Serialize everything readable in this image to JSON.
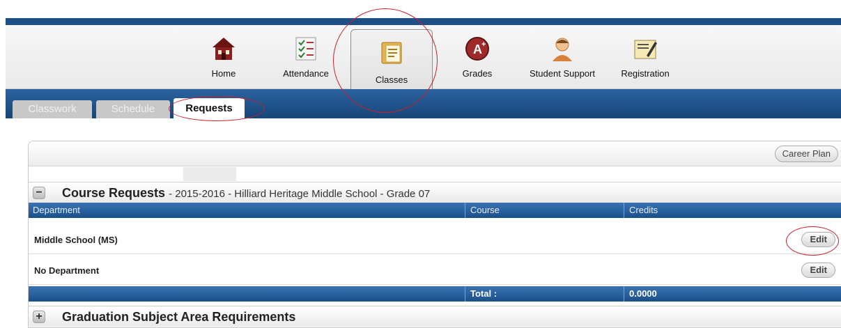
{
  "nav": {
    "items": [
      {
        "label": "Home",
        "icon": "home-icon"
      },
      {
        "label": "Attendance",
        "icon": "attendance-icon"
      },
      {
        "label": "Classes",
        "icon": "classes-icon",
        "active": true
      },
      {
        "label": "Grades",
        "icon": "grades-icon"
      },
      {
        "label": "Student Support",
        "icon": "student-support-icon"
      },
      {
        "label": "Registration",
        "icon": "registration-icon"
      }
    ]
  },
  "tabs": [
    {
      "label": "Classwork",
      "active": false
    },
    {
      "label": "Schedule",
      "active": false
    },
    {
      "label": "Requests",
      "active": true
    }
  ],
  "career_plan_label": "Career Plan",
  "course_requests": {
    "toggle": "−",
    "title": "Course Requests",
    "subtitle": "- 2015-2016 - Hilliard Heritage Middle School - Grade 07",
    "columns": [
      "Department",
      "Course",
      "Credits"
    ],
    "rows": [
      {
        "department": "Middle School (MS)",
        "action": "Edit"
      },
      {
        "department": "No Department",
        "action": "Edit"
      }
    ],
    "total_label": "Total :",
    "total_value": "0.0000"
  },
  "graduation": {
    "toggle": "+",
    "title": "Graduation Subject Area Requirements"
  },
  "colors": {
    "header_blue": "#1e4f86",
    "table_header_blue": "#2b62a0",
    "annotation_red": "#c8202a"
  }
}
